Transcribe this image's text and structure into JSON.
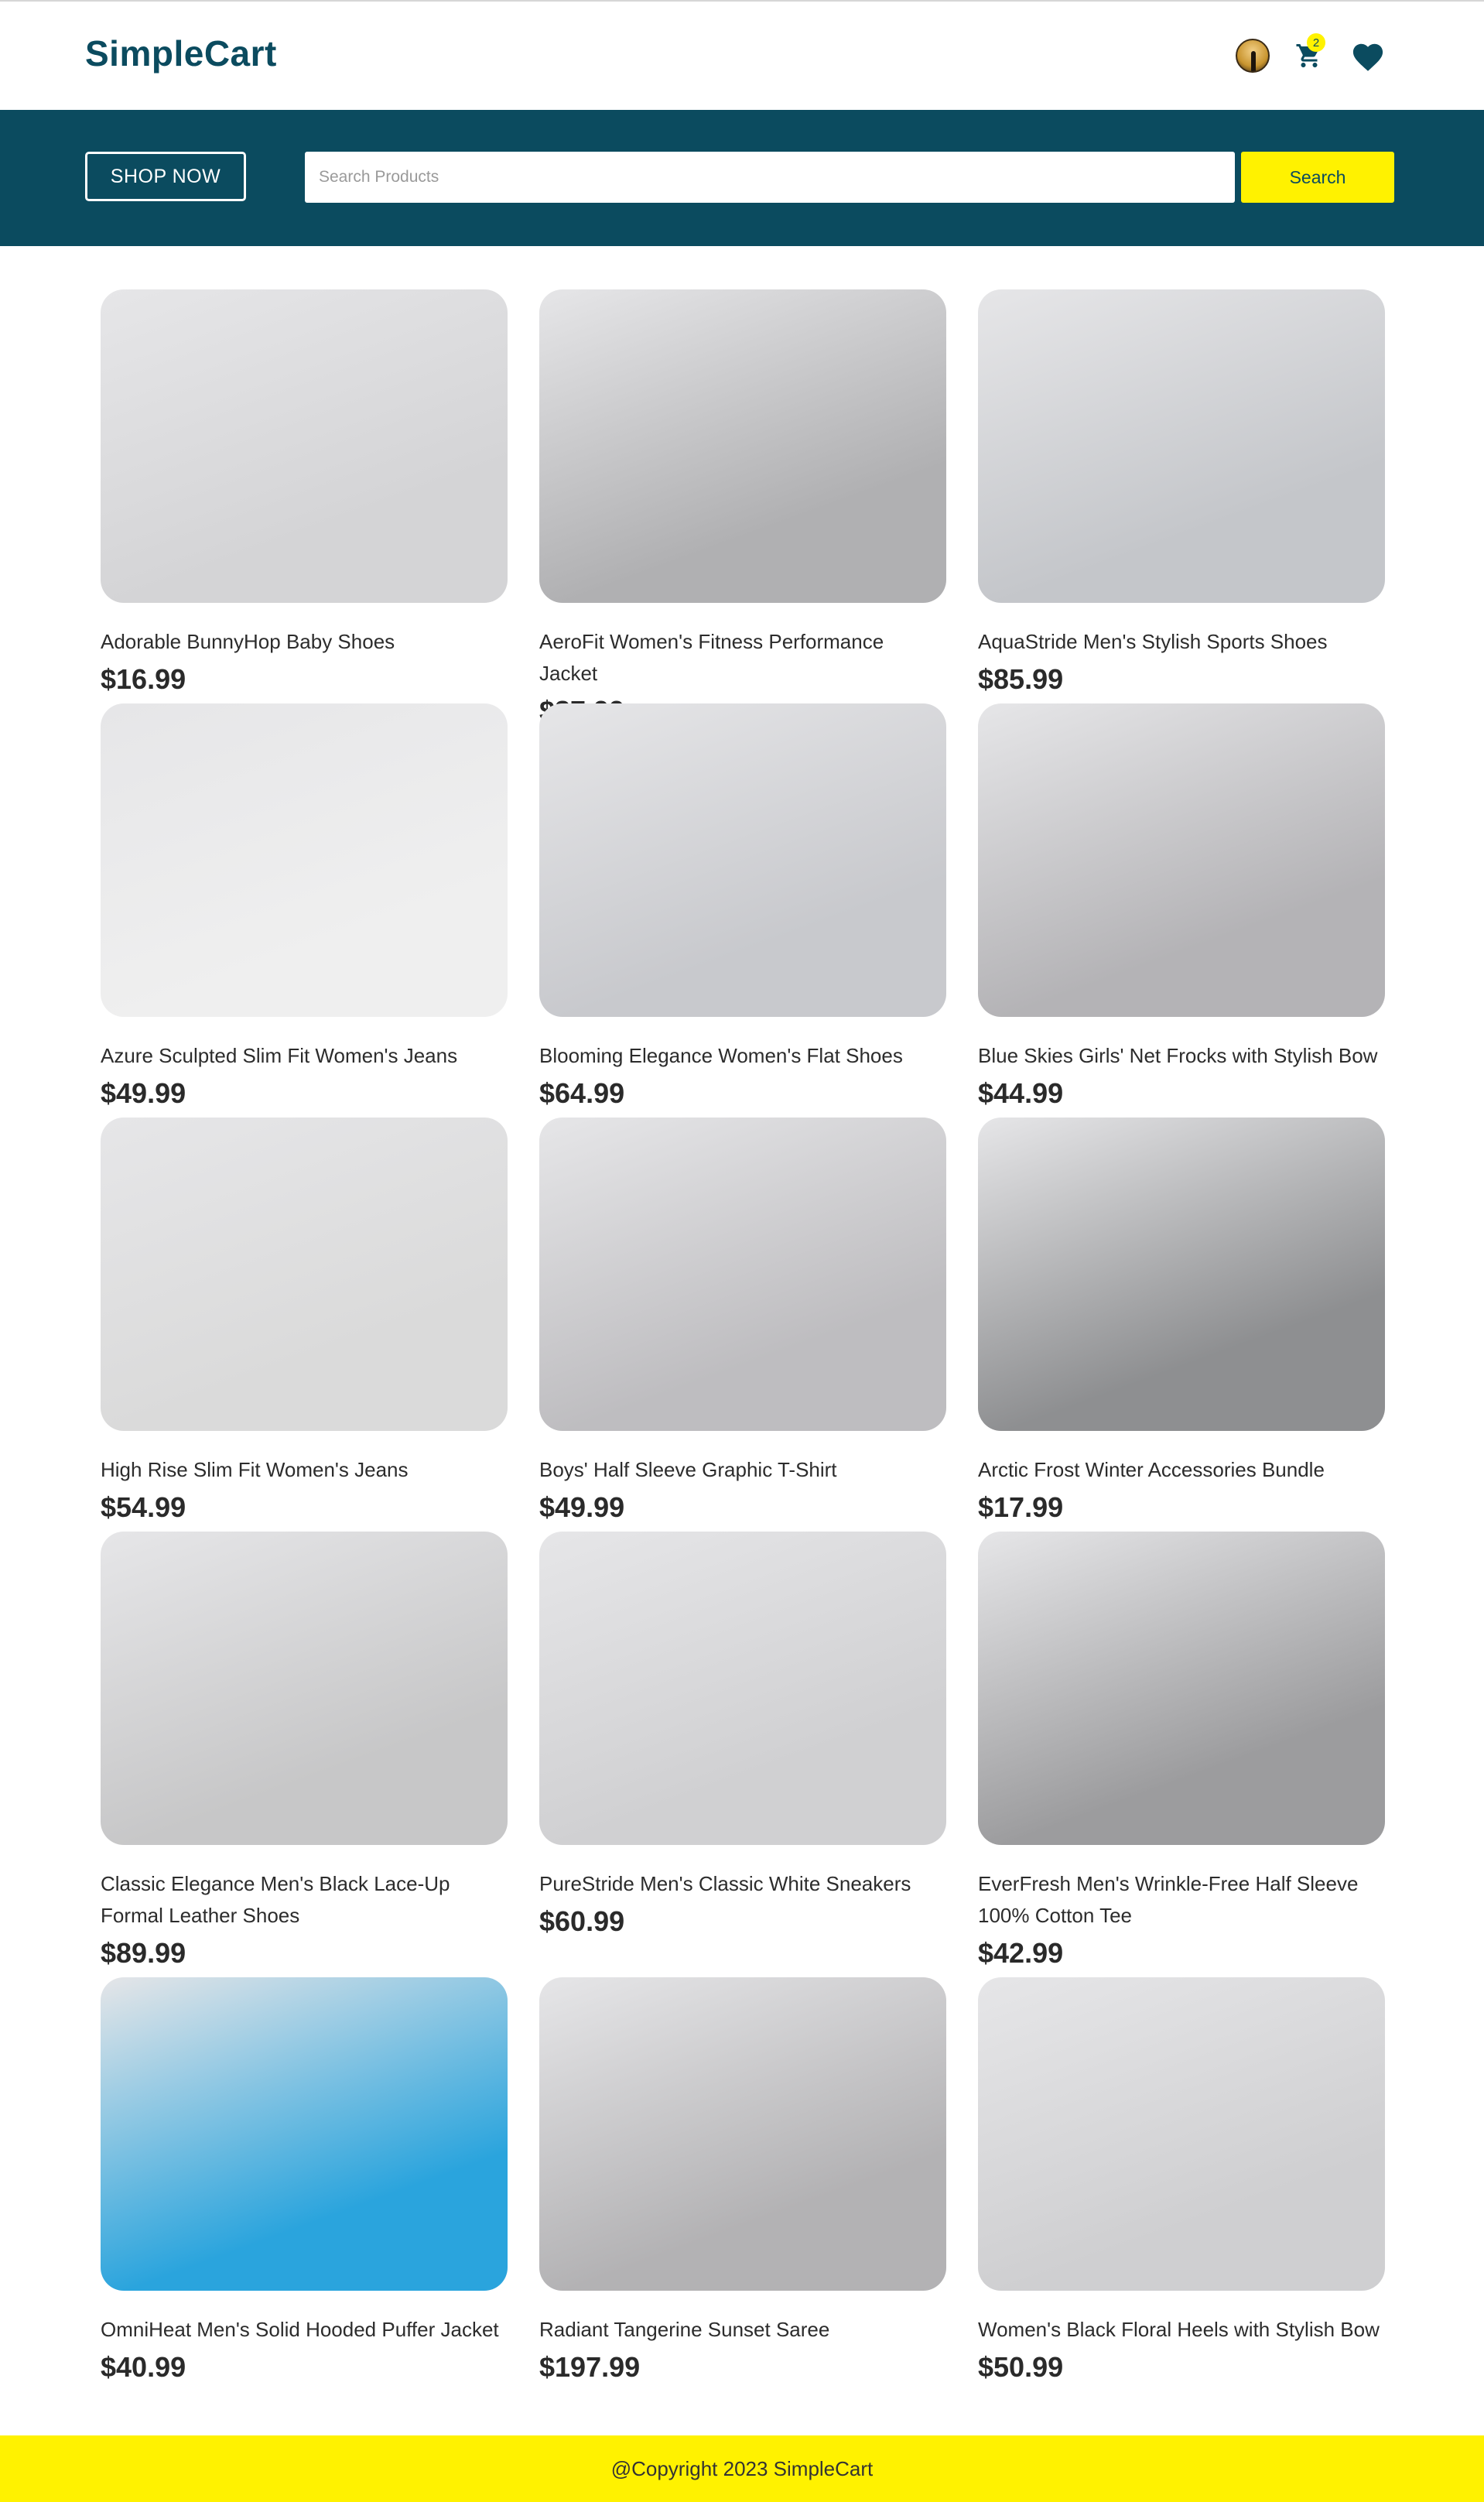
{
  "header": {
    "logo": "SimpleCart",
    "cart_count": "2"
  },
  "banner": {
    "shop_now_label": "SHOP NOW",
    "search_placeholder": "Search Products",
    "search_value": "",
    "search_button_label": "Search"
  },
  "products": [
    {
      "title": "Adorable BunnyHop Baby Shoes",
      "price": "$16.99",
      "image_color": "#d4d4d6",
      "icon": "baby-shoes-image"
    },
    {
      "title": "AeroFit Women's Fitness Performance Jacket",
      "price": "$87.99",
      "image_color": "#b0b0b2",
      "icon": "pink-jacket-image"
    },
    {
      "title": "AquaStride Men's Stylish Sports Shoes",
      "price": "$85.99",
      "image_color": "#c4c6ca",
      "icon": "sports-shoes-image"
    },
    {
      "title": "Azure Sculpted Slim Fit Women's Jeans",
      "price": "$49.99",
      "image_color": "#efefef",
      "icon": "jeans-image"
    },
    {
      "title": "Blooming Elegance Women's Flat Shoes",
      "price": "$64.99",
      "image_color": "#c8c9cd",
      "icon": "flat-shoes-image"
    },
    {
      "title": "Blue Skies Girls' Net Frocks with Stylish Bow",
      "price": "$44.99",
      "image_color": "#b4b3b6",
      "icon": "frock-image"
    },
    {
      "title": "High Rise Slim Fit Women's Jeans",
      "price": "$54.99",
      "image_color": "#dadada",
      "icon": "jeans-image"
    },
    {
      "title": "Boys' Half Sleeve Graphic T-Shirt",
      "price": "$49.99",
      "image_color": "#bebdc0",
      "icon": "tshirt-image"
    },
    {
      "title": "Arctic Frost Winter Accessories Bundle",
      "price": "$17.99",
      "image_color": "#8e8f91",
      "icon": "winter-accessories-image"
    },
    {
      "title": "Classic Elegance Men's Black Lace-Up Formal Leather Shoes",
      "price": "$89.99",
      "image_color": "#c7c7c8",
      "icon": "formal-shoes-image"
    },
    {
      "title": "PureStride Men's Classic White Sneakers",
      "price": "$60.99",
      "image_color": "#d0d0d2",
      "icon": "white-sneakers-image"
    },
    {
      "title": "EverFresh Men's Wrinkle-Free Half Sleeve 100% Cotton Tee",
      "price": "$42.99",
      "image_color": "#9c9c9e",
      "icon": "cotton-tee-image"
    },
    {
      "title": "OmniHeat Men's Solid Hooded Puffer Jacket",
      "price": "$40.99",
      "image_color": "#2aa4dd",
      "icon": "puffer-jacket-image"
    },
    {
      "title": "Radiant Tangerine Sunset Saree",
      "price": "$197.99",
      "image_color": "#b3b2b4",
      "icon": "saree-image"
    },
    {
      "title": "Women's Black Floral Heels with Stylish Bow",
      "price": "$50.99",
      "image_color": "#cfcfd1",
      "icon": "floral-heels-image"
    }
  ],
  "footer": {
    "copyright": "@Copyright 2023 SimpleCart"
  },
  "colors": {
    "brand": "#0b4b5f",
    "accent": "#fff200"
  }
}
